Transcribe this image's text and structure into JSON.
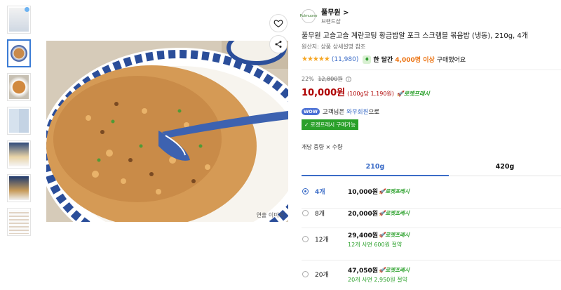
{
  "brand": {
    "name": "풀무원 >",
    "sub": "브랜드샵",
    "logo": "Pulmuone"
  },
  "product": {
    "title": "풀무원 고슬고슬 계란코팅 황금밥알 포크 스크램블 볶음밥 (냉동), 210g, 4개",
    "origin": "원산지: 상품 상세설명 참조",
    "stars": "★★★★★",
    "review_count": "(11,980)",
    "popularity_prefix": "한 달간",
    "popularity_highlight": "4,000명 이상",
    "popularity_suffix": "구매했어요"
  },
  "pricing": {
    "discount": "22%",
    "original": "12,800원",
    "info": "i",
    "price": "10,000원",
    "unit_price": "(100g당 1,190원)",
    "rocket": "로켓프레시"
  },
  "wow": {
    "badge": "WOW",
    "text": "고객님은",
    "link": "와우회원",
    "tail": "으로",
    "fresh_button": "✓ 로켓프레시 구매가능"
  },
  "options": {
    "label": "개당 중량 × 수량",
    "tabs": [
      {
        "label": "210g"
      },
      {
        "label": "420g"
      }
    ],
    "rows": [
      {
        "qty": "4개",
        "price": "10,000원",
        "rocket": "로켓프레시",
        "save": ""
      },
      {
        "qty": "8개",
        "price": "20,000원",
        "rocket": "로켓프레시",
        "save": ""
      },
      {
        "qty": "12개",
        "price": "29,400원",
        "rocket": "로켓프레시",
        "save": "12개 사면 600원 절약"
      },
      {
        "qty": "20개",
        "price": "47,050원",
        "rocket": "로켓프레시",
        "save": "20개 사면 2,950원 절약"
      }
    ]
  },
  "image": {
    "caption": "연출 이미지"
  },
  "icons": {
    "heart": "heart-icon",
    "share": "share-icon"
  },
  "colors": {
    "price_red": "#ae0000",
    "accent_blue": "#3b6cc7",
    "rocket_green": "#2aa02a",
    "star": "#f6a623"
  }
}
